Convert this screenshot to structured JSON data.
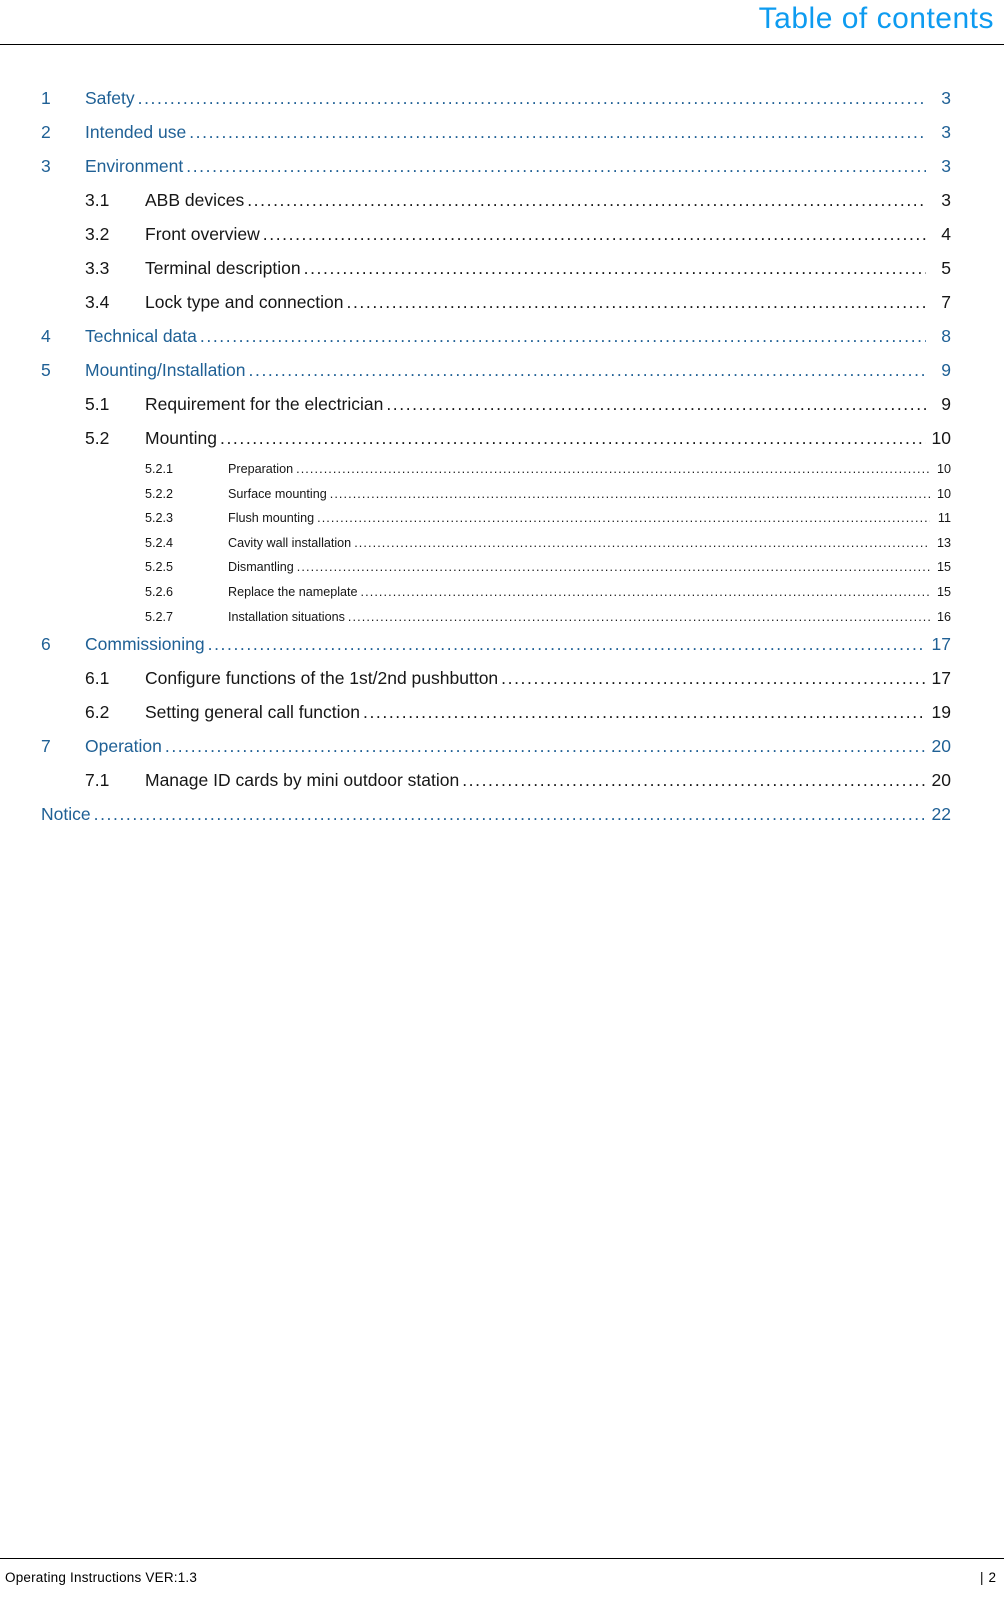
{
  "header": {
    "title": "Table of contents"
  },
  "colors": {
    "header_title_blue": "#0d9bf0",
    "level1_blue": "#1f6095",
    "body_black": "#161616"
  },
  "toc": {
    "entries": [
      {
        "level": 1,
        "number": "1",
        "title": "Safety",
        "page": "3"
      },
      {
        "level": 1,
        "number": "2",
        "title": "Intended use",
        "page": "3"
      },
      {
        "level": 1,
        "number": "3",
        "title": "Environment",
        "page": "3"
      },
      {
        "level": 2,
        "number": "3.1",
        "title": "ABB devices",
        "page": "3"
      },
      {
        "level": 2,
        "number": "3.2",
        "title": "Front overview",
        "page": "4"
      },
      {
        "level": 2,
        "number": "3.3",
        "title": "Terminal description",
        "page": "5"
      },
      {
        "level": 2,
        "number": "3.4",
        "title": "Lock type and connection",
        "page": "7"
      },
      {
        "level": 1,
        "number": "4",
        "title": "Technical data",
        "page": "8"
      },
      {
        "level": 1,
        "number": "5",
        "title": "Mounting/Installation",
        "page": "9"
      },
      {
        "level": 2,
        "number": "5.1",
        "title": "Requirement for the electrician",
        "page": "9"
      },
      {
        "level": 2,
        "number": "5.2",
        "title": "Mounting",
        "page": "10"
      },
      {
        "level": 3,
        "number": "5.2.1",
        "title": "Preparation",
        "page": "10"
      },
      {
        "level": 3,
        "number": "5.2.2",
        "title": "Surface mounting",
        "page": "10"
      },
      {
        "level": 3,
        "number": "5.2.3",
        "title": "Flush mounting",
        "page": "11"
      },
      {
        "level": 3,
        "number": "5.2.4",
        "title": "Cavity wall installation",
        "page": "13"
      },
      {
        "level": 3,
        "number": "5.2.5",
        "title": "Dismantling",
        "page": "15"
      },
      {
        "level": 3,
        "number": "5.2.6",
        "title": "Replace the nameplate",
        "page": "15"
      },
      {
        "level": 3,
        "number": "5.2.7",
        "title": "Installation situations",
        "page": "16"
      },
      {
        "level": 1,
        "number": "6",
        "title": "Commissioning",
        "page": "17"
      },
      {
        "level": 2,
        "number": "6.1",
        "title": "Configure functions of the 1st/2nd pushbutton",
        "page": "17"
      },
      {
        "level": 2,
        "number": "6.2",
        "title": "Setting general call function",
        "page": "19"
      },
      {
        "level": 1,
        "number": "7",
        "title": "Operation",
        "page": "20"
      },
      {
        "level": 2,
        "number": "7.1",
        "title": "Manage ID cards by mini outdoor station",
        "page": "20"
      },
      {
        "level": 0,
        "number": "",
        "title": "Notice",
        "page": "22"
      }
    ]
  },
  "footer": {
    "left_text": "Operating Instructions VER:1.3",
    "separator": "|",
    "page_number": "2"
  }
}
